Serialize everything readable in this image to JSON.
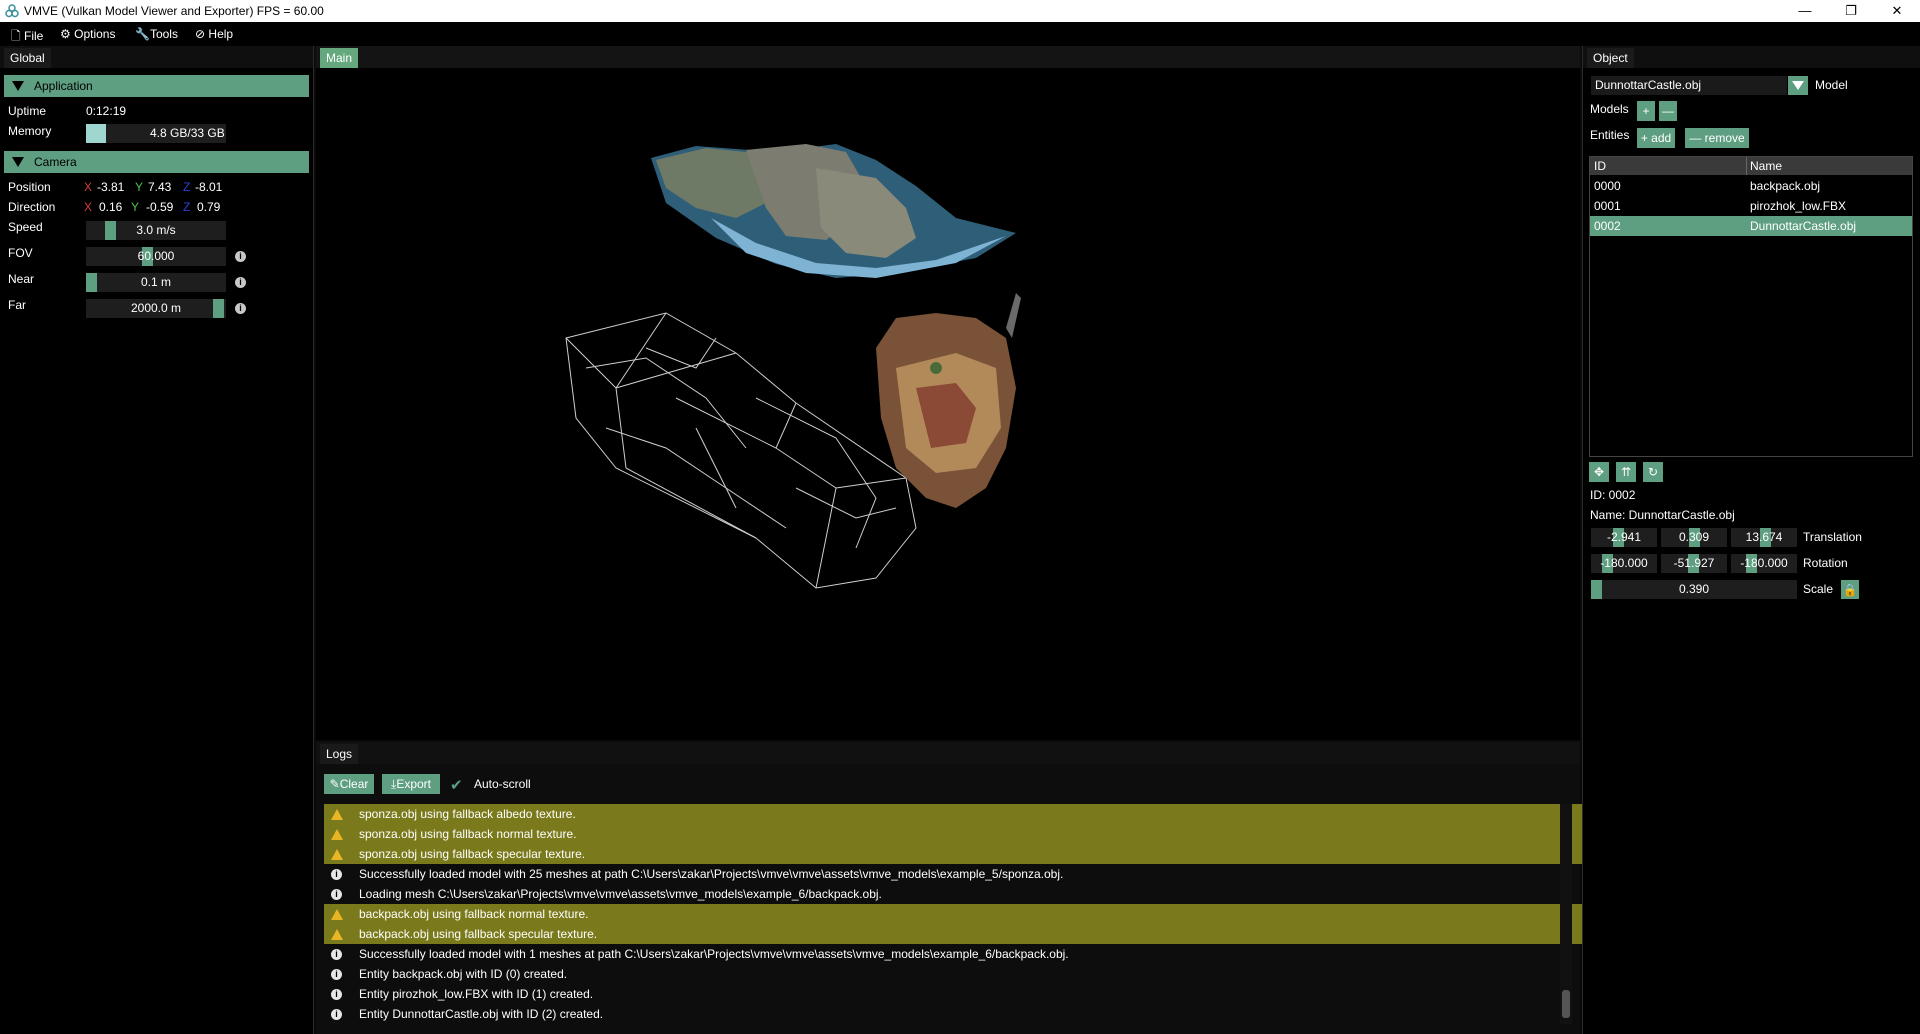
{
  "window": {
    "title": "VMVE (Vulkan Model Viewer and Exporter)   FPS = 60.00",
    "minimize": "—",
    "maximize": "❐",
    "close": "✕"
  },
  "menu": [
    {
      "icon": "file-icon",
      "label": "File"
    },
    {
      "icon": "gear-icon",
      "label": "Options"
    },
    {
      "icon": "wrench-icon",
      "label": "Tools"
    },
    {
      "icon": "help-icon",
      "label": "Help"
    }
  ],
  "global": {
    "tab": "Global",
    "application": {
      "header": "Application",
      "uptime_label": "Uptime",
      "uptime": "0:12:19",
      "memory_label": "Memory",
      "memory": "4.8 GB/33 GB",
      "memory_fraction": 0.145
    },
    "camera": {
      "header": "Camera",
      "position_label": "Position",
      "position": {
        "x": "-3.81",
        "y": "7.43",
        "z": "-8.01"
      },
      "direction_label": "Direction",
      "direction": {
        "x": "0.16",
        "y": "-0.59",
        "z": "0.79"
      },
      "axis_x": "X",
      "axis_y": "Y",
      "axis_z": "Z",
      "speed_label": "Speed",
      "speed": "3.0 m/s",
      "fov_label": "FOV",
      "fov": "60.000",
      "near_label": "Near",
      "near": "0.1 m",
      "far_label": "Far",
      "far": "2000.0 m"
    }
  },
  "main": {
    "tab": "Main"
  },
  "logs": {
    "tab": "Logs",
    "clear": "Clear",
    "export": "Export",
    "autoscroll": "Auto-scroll",
    "entries": [
      {
        "level": "warn",
        "text": "sponza.obj using fallback albedo texture."
      },
      {
        "level": "warn",
        "text": "sponza.obj using fallback normal texture."
      },
      {
        "level": "warn",
        "text": "sponza.obj using fallback specular texture."
      },
      {
        "level": "info",
        "text": "Successfully loaded model with 25 meshes at path C:\\Users\\zakar\\Projects\\vmve\\vmve\\assets\\vmve_models\\example_5/sponza.obj."
      },
      {
        "level": "info",
        "text": "Loading mesh C:\\Users\\zakar\\Projects\\vmve\\vmve\\assets\\vmve_models\\example_6/backpack.obj."
      },
      {
        "level": "warn",
        "text": "backpack.obj using fallback normal texture."
      },
      {
        "level": "warn",
        "text": "backpack.obj using fallback specular texture."
      },
      {
        "level": "info",
        "text": "Successfully loaded model with 1 meshes at path C:\\Users\\zakar\\Projects\\vmve\\vmve\\assets\\vmve_models\\example_6/backpack.obj."
      },
      {
        "level": "info",
        "text": "Entity backpack.obj with ID (0) created."
      },
      {
        "level": "info",
        "text": "Entity pirozhok_low.FBX with ID (1) created."
      },
      {
        "level": "info",
        "text": "Entity DunnottarCastle.obj with ID (2) created."
      }
    ]
  },
  "object": {
    "tab": "Object",
    "model_select": "DunnottarCastle.obj",
    "model_label": "Model",
    "models_label": "Models",
    "models_add": "+",
    "models_remove": "—",
    "entities_label": "Entities",
    "entities_add": "+ add",
    "entities_remove": "— remove",
    "table": {
      "headers": [
        "ID",
        "Name"
      ],
      "rows": [
        {
          "id": "0000",
          "name": "backpack.obj"
        },
        {
          "id": "0001",
          "name": "pirozhok_low.FBX"
        },
        {
          "id": "0002",
          "name": "DunnottarCastle.obj"
        }
      ]
    },
    "selected_id": "ID: 0002",
    "selected_name": "Name: DunnottarCastle.obj",
    "translation": {
      "x": "-2.941",
      "y": "0.309",
      "z": "13.674",
      "label": "Translation"
    },
    "rotation": {
      "x": "-180.000",
      "y": "-51.927",
      "z": "-180.000",
      "label": "Rotation"
    },
    "scale": {
      "value": "0.390",
      "label": "Scale"
    }
  },
  "colors": {
    "accent": "#5e9e81",
    "tab_active": "#65a87e",
    "warn_row": "#7a7a1c",
    "selected_row": "#5e9e81"
  }
}
